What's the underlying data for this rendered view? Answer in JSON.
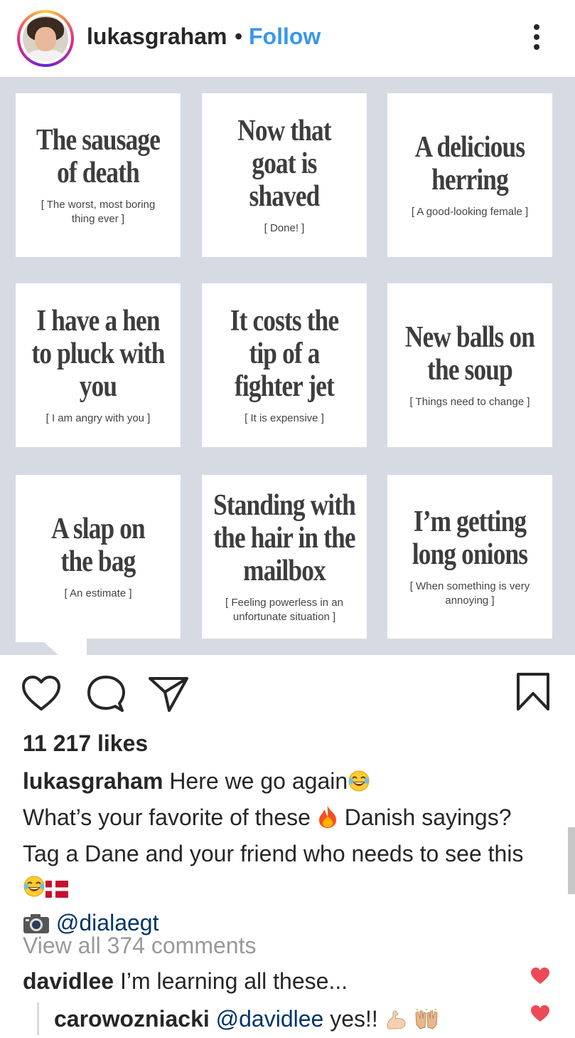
{
  "post": {
    "username": "lukasgraham",
    "separator": "•",
    "follow_label": "Follow",
    "more_icon": "more-vertical-icon"
  },
  "cards": [
    {
      "saying": "The sausage of death",
      "meaning": "[ The worst, most boring thing ever ]"
    },
    {
      "saying": "Now that goat is shaved",
      "meaning": "[ Done! ]"
    },
    {
      "saying": "A delicious herring",
      "meaning": "[ A good-looking female ]"
    },
    {
      "saying": "I have a hen to pluck with you",
      "meaning": "[ I am angry with you ]"
    },
    {
      "saying": "It costs the tip of a fighter jet",
      "meaning": "[ It is expensive ]"
    },
    {
      "saying": "New balls on the soup",
      "meaning": "[ Things need to change ]"
    },
    {
      "saying": "A slap on the bag",
      "meaning": "[ An estimate ]"
    },
    {
      "saying": "Standing with the hair in the mailbox",
      "meaning": "[ Feeling powerless in an unfortunate situation ]"
    },
    {
      "saying": "I’m getting long onions",
      "meaning": "[ When something is very annoying ]"
    }
  ],
  "actions": {
    "like_icon": "heart-icon",
    "comment_icon": "comment-icon",
    "share_icon": "send-icon",
    "save_icon": "bookmark-icon"
  },
  "likes_text": "11 217 likes",
  "caption": {
    "username": "lukasgraham",
    "line1": "Here we go again",
    "line2a": "What’s your favorite of these",
    "line2b": "Danish sayings?",
    "line3": "Tag a Dane and your friend who needs to see this",
    "photo_credit": "@dialaegt"
  },
  "view_all_comments": "View all 374 comments",
  "comments": [
    {
      "username": "davidlee",
      "text": "I’m learning all these..."
    },
    {
      "username": "carowozniacki",
      "mention": "@davidlee",
      "text": "yes!!"
    }
  ],
  "colors": {
    "link_blue": "#3897f0",
    "mention": "#003569",
    "heart_red": "#ed4956",
    "image_bg": "#d6dae3"
  }
}
